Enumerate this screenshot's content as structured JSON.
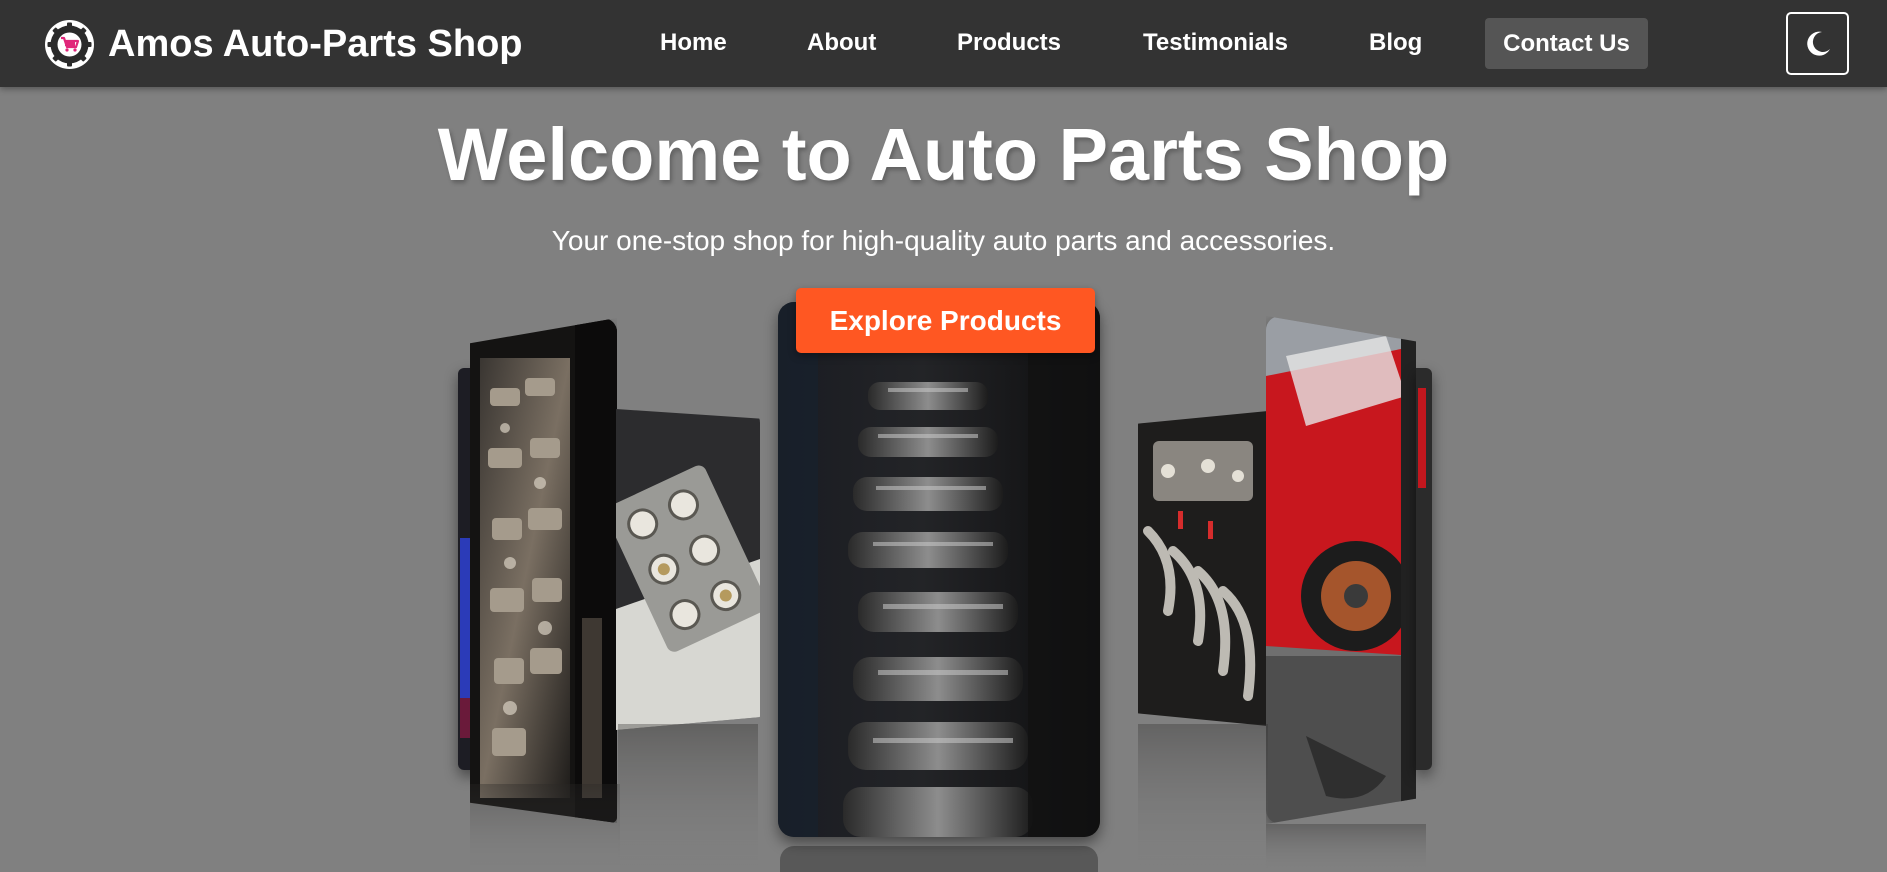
{
  "brand": {
    "name": "Amos Auto-Parts Shop",
    "logo_icon": "gear-cart-logo"
  },
  "nav": {
    "items": [
      {
        "label": "Home"
      },
      {
        "label": "About"
      },
      {
        "label": "Products"
      },
      {
        "label": "Testimonials"
      },
      {
        "label": "Blog"
      }
    ],
    "contact_label": "Contact Us",
    "theme_icon": "moon-icon"
  },
  "hero": {
    "title": "Welcome to Auto Parts Shop",
    "subtitle": "Your one-stop shop for high-quality auto parts and accessories.",
    "cta_label": "Explore Products"
  },
  "carousel": {
    "images": [
      "engine-block-photo",
      "carburetor-photo",
      "camshaft-photo",
      "engine-manifold-photo",
      "red-car-brake-photo"
    ]
  },
  "colors": {
    "nav_bg": "#333333",
    "page_bg": "#808080",
    "cta": "#ff5722",
    "contact_bg": "#555555",
    "logo_accent": "#e0267a"
  }
}
